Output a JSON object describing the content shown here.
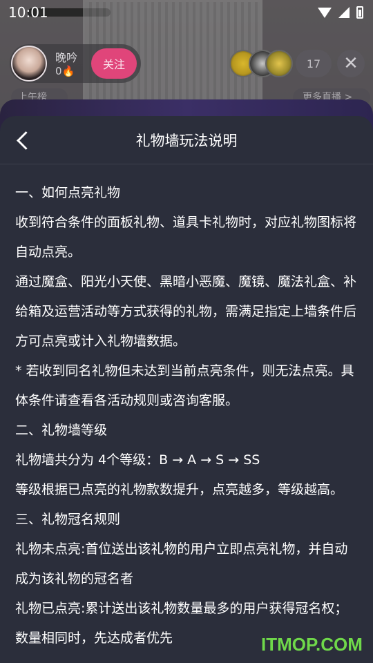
{
  "status_bar": {
    "time": "10:01"
  },
  "host": {
    "name": "晚吟",
    "fans": "0🔥",
    "follow_label": "关注"
  },
  "viewers": {
    "count": "17"
  },
  "chips": {
    "left": "上午榜",
    "right": "更多直播 >"
  },
  "sheet": {
    "title": "礼物墙玩法说明"
  },
  "content": {
    "paragraphs": [
      "一、如何点亮礼物",
      " 收到符合条件的面板礼物、道具卡礼物时，对应礼物图标将自动点亮。",
      " 通过魔盒、阳光小天使、黑暗小恶魔、魔镜、魔法礼盒、补给箱及运营活动等方式获得的礼物，需满足指定上墙条件后方可点亮或计入礼物墙数据。",
      " * 若收到同名礼物但未达到当前点亮条件，则无法点亮。具体条件请查看各活动规则或咨询客服。",
      "  二、礼物墙等级",
      " 礼物墙共分为 4个等级：B → A → S → SS",
      " 等级根据已点亮的礼物款数提升，点亮越多，等级越高。",
      "  三、礼物冠名规则",
      " 礼物未点亮:首位送出该礼物的用户立即点亮礼物，并自动成为该礼物的冠名者",
      " 礼物已点亮:累计送出该礼物数量最多的用户获得冠名权；数量相同时，先达成者优先"
    ]
  },
  "watermark": "ITMOP.COM"
}
